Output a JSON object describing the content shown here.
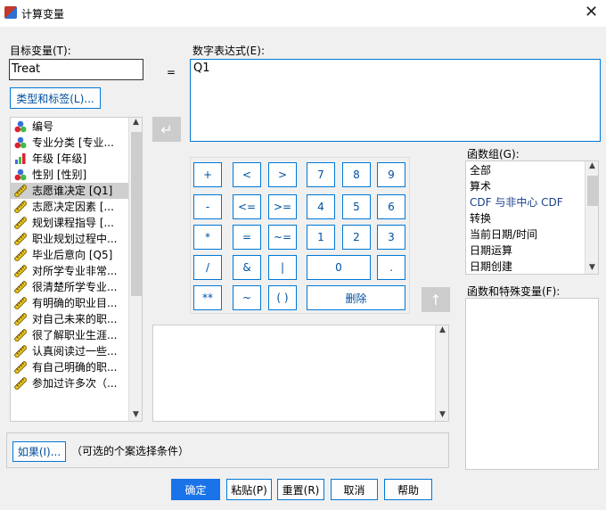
{
  "window": {
    "title": "计算变量",
    "close": "✕"
  },
  "target": {
    "label": "目标变量(T):",
    "value": "Treat",
    "type_label_button": "类型和标签(L)..."
  },
  "equals": "=",
  "expression": {
    "label": "数字表达式(E):",
    "value": "Q1"
  },
  "variables": [
    {
      "label": "编号",
      "icon": "nominal"
    },
    {
      "label": "专业分类 [专业...",
      "icon": "nominal"
    },
    {
      "label": "年级 [年级]",
      "icon": "ordinal"
    },
    {
      "label": "性别 [性别]",
      "icon": "nominal"
    },
    {
      "label": "志愿谁决定 [Q1]",
      "icon": "scale",
      "selected": true
    },
    {
      "label": "志愿决定因素 [...",
      "icon": "scale"
    },
    {
      "label": "规划课程指导 [...",
      "icon": "scale"
    },
    {
      "label": "职业规划过程中...",
      "icon": "scale"
    },
    {
      "label": "毕业后意向 [Q5]",
      "icon": "scale"
    },
    {
      "label": "对所学专业非常...",
      "icon": "scale"
    },
    {
      "label": "很清楚所学专业...",
      "icon": "scale"
    },
    {
      "label": "有明确的职业目...",
      "icon": "scale"
    },
    {
      "label": "对自己未来的职...",
      "icon": "scale"
    },
    {
      "label": "很了解职业生涯...",
      "icon": "scale"
    },
    {
      "label": "认真阅读过一些...",
      "icon": "scale"
    },
    {
      "label": "有自己明确的职...",
      "icon": "scale"
    },
    {
      "label": "参加过许多次（...",
      "icon": "scale"
    }
  ],
  "keypad": [
    "+",
    "<",
    ">",
    "7",
    "8",
    "9",
    "-",
    "<=",
    ">=",
    "4",
    "5",
    "6",
    "*",
    "=",
    "~=",
    "1",
    "2",
    "3",
    "/",
    "&",
    "|",
    "0",
    ".",
    "**",
    "~",
    "( )",
    "删除"
  ],
  "function_group": {
    "label": "函数组(G):",
    "items": [
      "全部",
      "算术",
      "CDF 与非中心 CDF",
      "转换",
      "当前日期/时间",
      "日期运算",
      "日期创建"
    ]
  },
  "functions": {
    "label": "函数和特殊变量(F):",
    "items": []
  },
  "if": {
    "button": "如果(I)...",
    "hint": "（可选的个案选择条件）"
  },
  "buttons": {
    "ok": "确定",
    "paste": "粘贴(P)",
    "reset": "重置(R)",
    "cancel": "取消",
    "help": "帮助"
  },
  "colors": {
    "accent": "#0078d7",
    "ok_bg": "#1a73e8"
  }
}
